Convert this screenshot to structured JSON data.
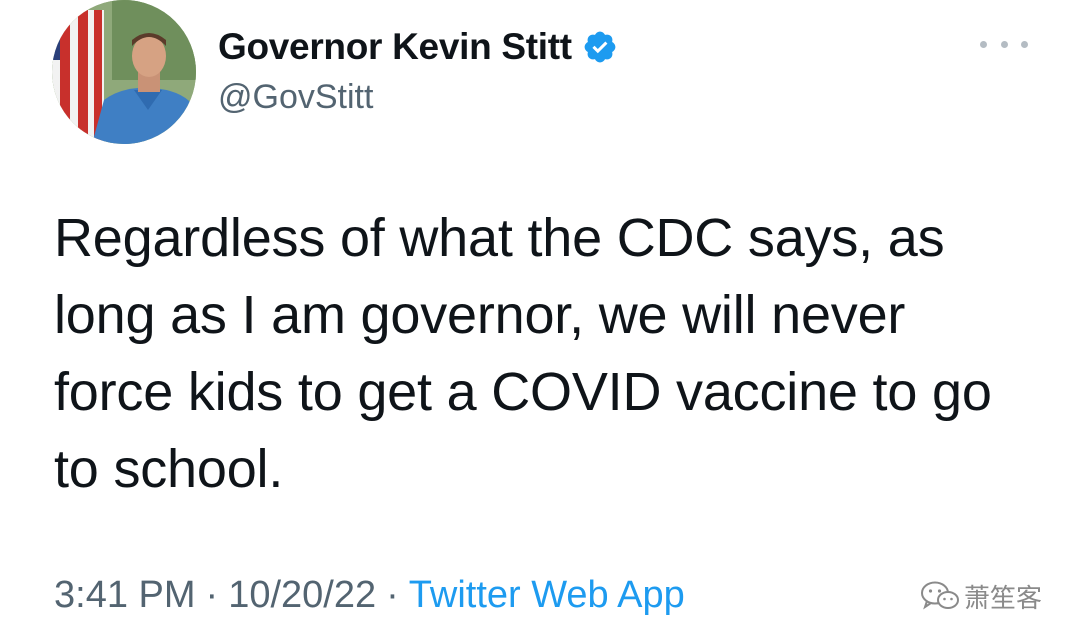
{
  "author": {
    "display_name": "Governor Kevin Stitt",
    "handle": "@GovStitt",
    "verified": true,
    "verified_color": "#1d9bf0"
  },
  "tweet": {
    "text": "Regardless of what the CDC says, as long as I am governor, we will never force kids to get a COVID vaccine to go to school."
  },
  "meta": {
    "time": "3:41 PM",
    "separator": "·",
    "date": "10/20/22",
    "source": "Twitter Web App"
  },
  "icons": {
    "more": "more-options-icon",
    "verified": "verified-badge-icon",
    "watermark": "wechat-icon"
  },
  "watermark": {
    "text": "萧笙客"
  },
  "colors": {
    "text": "#0f1419",
    "secondary": "#536471",
    "link": "#1d9bf0"
  }
}
